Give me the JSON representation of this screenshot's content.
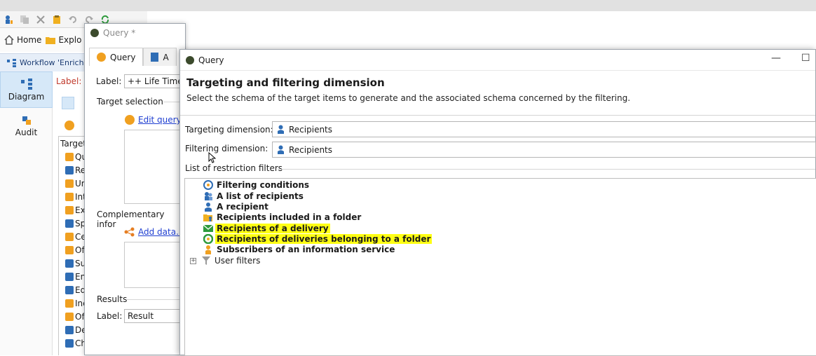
{
  "app": {
    "navbar": {
      "home_label": "Home",
      "explorer_label": "Explo"
    },
    "workflow_tab": "Workflow 'Enrich",
    "left_panel": {
      "diagram_label": "Diagram",
      "audit_label": "Audit"
    },
    "workflow_area": {
      "label_prefix": "Label:",
      "palette_header": "Target",
      "palette_items": [
        "Qu",
        "Re",
        "Un",
        "Int",
        "Exc",
        "Sp",
        "Ce",
        "Of",
        "Su",
        "En",
        "Ed",
        "Inc",
        "Of",
        "De",
        "Ch"
      ]
    }
  },
  "query_window": {
    "title": "Query *",
    "tabs": [
      "Query",
      "A"
    ],
    "label_caption": "Label:",
    "label_value": "++ Life Time V",
    "target_selection": "Target selection",
    "edit_query_link": "Edit query...",
    "complementary_info": "Complementary infor",
    "add_data_link": "Add data...",
    "results_caption": "Results",
    "result_label_caption": "Label:",
    "result_label_value": "Result"
  },
  "dialog": {
    "title": "Query",
    "minimize_glyph": "—",
    "maximize_glyph": "☐",
    "heading": "Targeting and filtering dimension",
    "description": "Select the schema of the target items to  generate and the associated schema concerned by the filtering.",
    "targeting_label": "Targeting dimension:",
    "targeting_value": "Recipients",
    "filtering_label": "Filtering dimension:",
    "filtering_value": "Recipients",
    "restriction_label": "List of restriction filters",
    "tree_items": [
      {
        "label": "Filtering conditions",
        "icon": "filter-conditions-icon",
        "highlighted": false
      },
      {
        "label": "A list of recipients",
        "icon": "recipients-list-icon",
        "highlighted": false
      },
      {
        "label": "A recipient",
        "icon": "recipient-icon",
        "highlighted": false
      },
      {
        "label": "Recipients included in a folder",
        "icon": "folder-recipients-icon",
        "highlighted": false
      },
      {
        "label": "Recipients of a delivery",
        "icon": "delivery-icon",
        "highlighted": true
      },
      {
        "label": "Recipients of deliveries belonging to a folder",
        "icon": "delivery-folder-icon",
        "highlighted": true
      },
      {
        "label": "Subscribers of an information service",
        "icon": "subscribers-icon",
        "highlighted": false
      }
    ],
    "user_filters_label": "User filters",
    "expander_glyph": "+"
  },
  "colors": {
    "highlight": "#ffff14",
    "link": "#1f3fd1",
    "recipient_blue": "#2f6db5",
    "query_orange": "#f0a020"
  }
}
